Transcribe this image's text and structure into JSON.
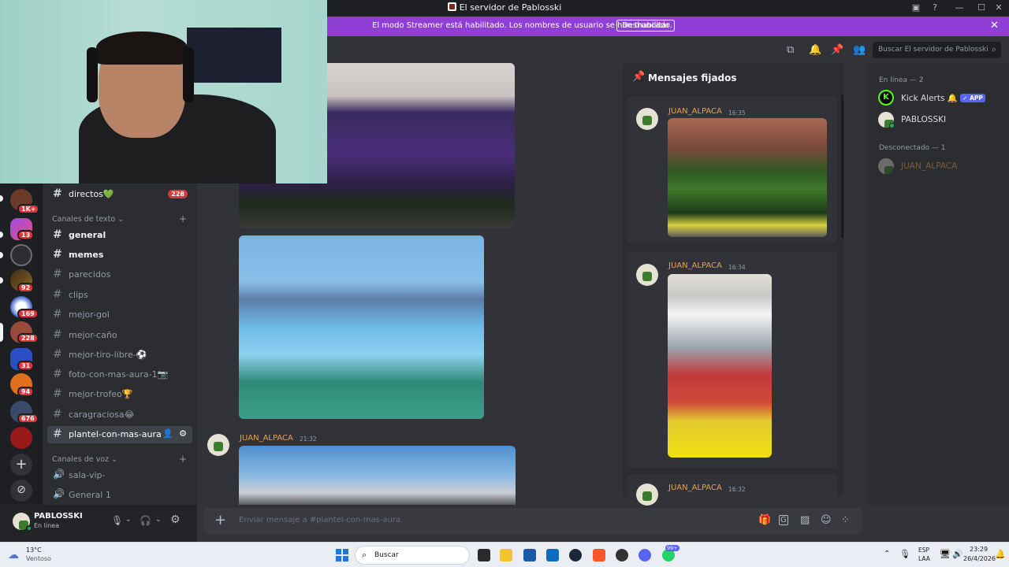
{
  "window": {
    "title": "El servidor de Pablosski"
  },
  "banner": {
    "text": "El modo Streamer está habilitado. Los nombres de usuario se han truncado.",
    "button": "Deshabilitar",
    "close": "✕"
  },
  "servers": [
    {
      "badge": "1K+"
    },
    {
      "badge": "13"
    },
    {
      "badge": ""
    },
    {
      "badge": "92"
    },
    {
      "badge": "169"
    },
    {
      "badge": "228"
    },
    {
      "badge": "31"
    },
    {
      "badge": "94"
    },
    {
      "badge": "676"
    },
    {
      "badge": ""
    }
  ],
  "channels": {
    "top": {
      "label": "directos💚",
      "badge": "228"
    },
    "text_category": "Canales de texto",
    "text": [
      {
        "label": "general"
      },
      {
        "label": "memes"
      },
      {
        "label": "parecidos"
      },
      {
        "label": "clips"
      },
      {
        "label": "mejor-gol"
      },
      {
        "label": "mejor-caño"
      },
      {
        "label": "mejor-tiro-libre-⚽"
      },
      {
        "label": "foto-con-mas-aura-1📷"
      },
      {
        "label": "mejor-trofeo🏆"
      },
      {
        "label": "caragraciosa😂"
      },
      {
        "label": "plantel-con-mas-aura"
      }
    ],
    "voice_category": "Canales de voz",
    "voice": [
      {
        "label": "sala-vip-"
      },
      {
        "label": "General 1"
      }
    ]
  },
  "user": {
    "name": "PABLOSSKI",
    "status": "En línea"
  },
  "chat": {
    "message": {
      "author": "JUAN_ALPACA",
      "time": "21:32"
    },
    "composer_placeholder": "Enviar mensaje a #plantel-con-mas-aura"
  },
  "search": {
    "placeholder": "Buscar El servidor de Pablosski"
  },
  "pinned": {
    "title": "Mensajes fijados",
    "items": [
      {
        "author": "JUAN_ALPACA",
        "time": "16:35"
      },
      {
        "author": "JUAN_ALPACA",
        "time": "16:34"
      },
      {
        "author": "JUAN_ALPACA",
        "time": "16:32"
      }
    ]
  },
  "members": {
    "online_header": "En línea — 2",
    "online": [
      {
        "name": "Kick Alerts 🔔",
        "tag": "✓ APP"
      },
      {
        "name": "PABLOSSKI"
      }
    ],
    "offline_header": "Desconectado — 1",
    "offline": [
      {
        "name": "JUAN_ALPACA"
      }
    ]
  },
  "taskbar": {
    "weather_temp": "13°C",
    "weather_desc": "Ventoso",
    "search": "Buscar",
    "lang1": "ESP",
    "lang2": "LAA",
    "time": "23:29",
    "date": "26/4/2026",
    "badge": "99+"
  },
  "colors": {
    "accent": "#5865f2",
    "banner": "#8f3ed6",
    "author": "#e8a24e",
    "mention": "#da373c"
  }
}
